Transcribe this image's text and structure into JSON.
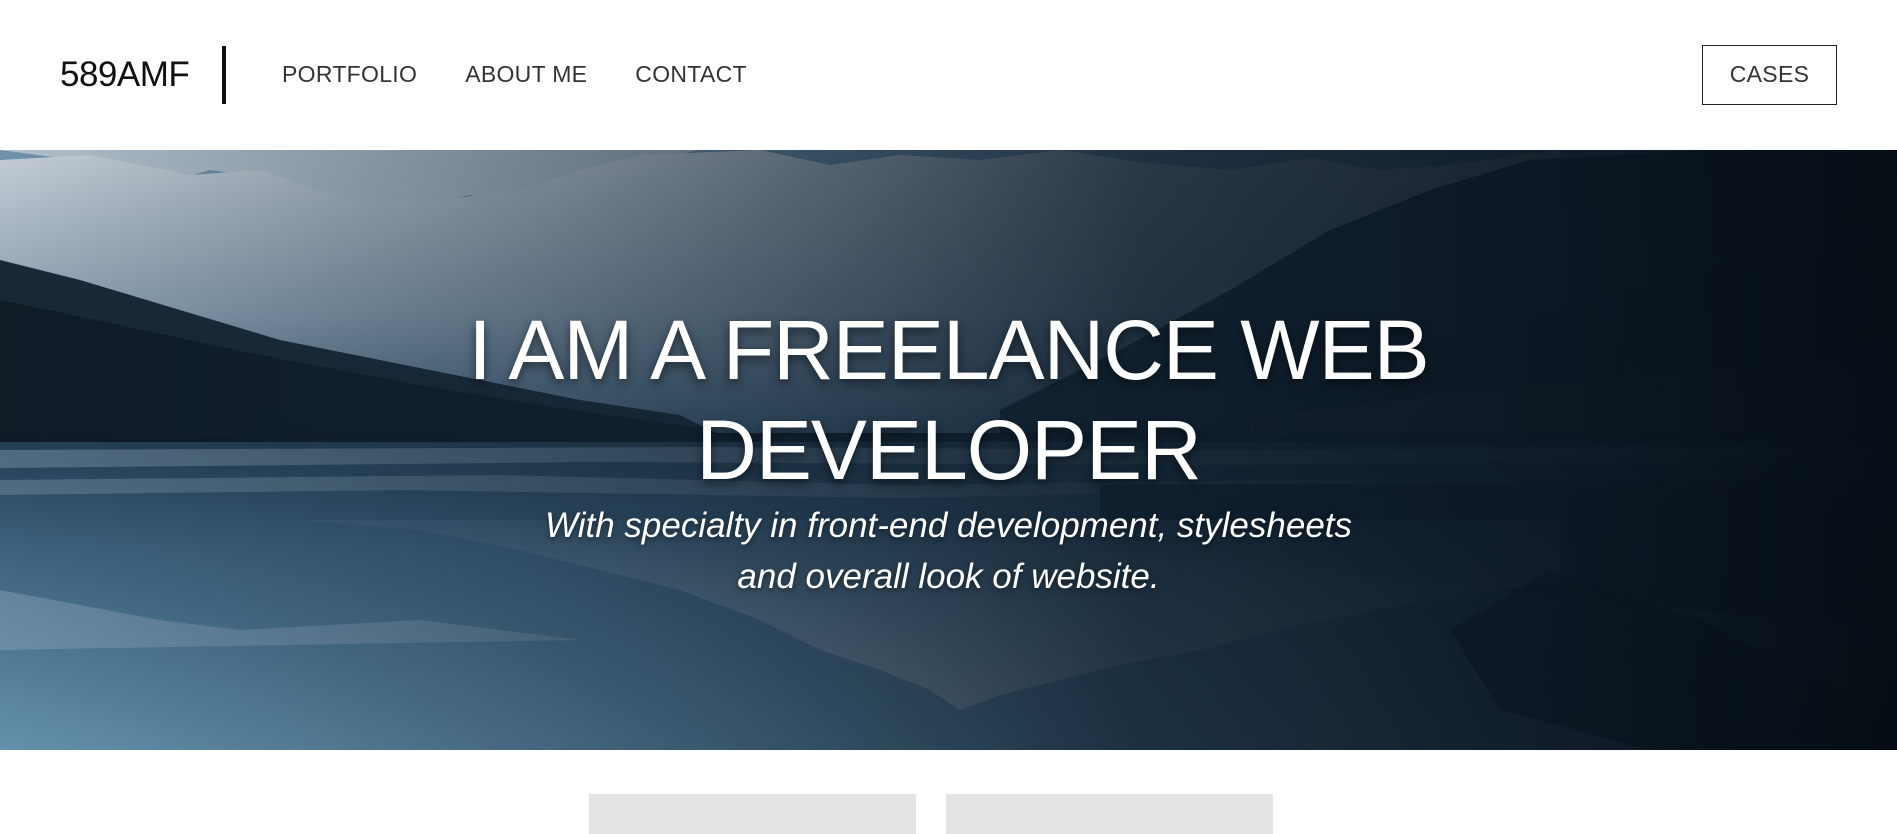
{
  "header": {
    "logo": "589AMF",
    "nav": [
      {
        "label": "PORTFOLIO"
      },
      {
        "label": "ABOUT ME"
      },
      {
        "label": "CONTACT"
      }
    ],
    "cases_label": "CASES"
  },
  "hero": {
    "title_line1": "I AM A FREELANCE WEB",
    "title_line2": "DEVELOPER",
    "subtitle_line1": "With specialty in front-end development, stylesheets",
    "subtitle_line2": "and overall look of website."
  },
  "colors": {
    "text_dark": "#111111",
    "hero_text": "#ffffff",
    "placeholder": "#e4e4e4"
  }
}
